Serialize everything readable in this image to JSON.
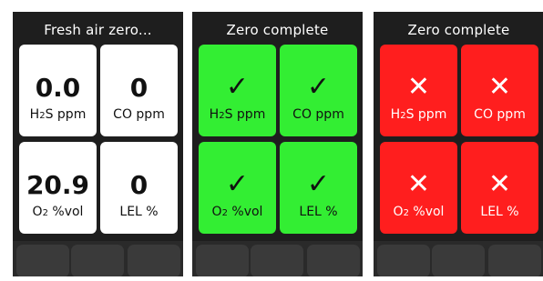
{
  "screens": [
    {
      "title": "Fresh air zero...",
      "tiles": [
        {
          "value": "0.0",
          "label_main": "H",
          "label_sub": "2",
          "label_rest": "S ppm"
        },
        {
          "value": "0",
          "label_main": "CO ppm",
          "label_sub": "",
          "label_rest": ""
        },
        {
          "value": "20.9",
          "label_main": "O",
          "label_sub": "2",
          "label_rest": " %vol"
        },
        {
          "value": "0",
          "label_main": "LEL %",
          "label_sub": "",
          "label_rest": ""
        }
      ],
      "colors": {
        "tile": "#ffffff"
      }
    },
    {
      "title": "Zero complete",
      "status": "success",
      "tiles": [
        {
          "glyph": "✓",
          "label_main": "H",
          "label_sub": "2",
          "label_rest": "S ppm"
        },
        {
          "glyph": "✓",
          "label_main": "CO ppm",
          "label_sub": "",
          "label_rest": ""
        },
        {
          "glyph": "✓",
          "label_main": "O",
          "label_sub": "2",
          "label_rest": " %vol"
        },
        {
          "glyph": "✓",
          "label_main": "LEL %",
          "label_sub": "",
          "label_rest": ""
        }
      ],
      "colors": {
        "tile": "#33ee33"
      }
    },
    {
      "title": "Zero complete",
      "status": "failure",
      "tiles": [
        {
          "glyph": "✕",
          "label_main": "H",
          "label_sub": "2",
          "label_rest": "S ppm"
        },
        {
          "glyph": "✕",
          "label_main": "CO ppm",
          "label_sub": "",
          "label_rest": ""
        },
        {
          "glyph": "✕",
          "label_main": "O",
          "label_sub": "2",
          "label_rest": " %vol"
        },
        {
          "glyph": "✕",
          "label_main": "LEL %",
          "label_sub": "",
          "label_rest": ""
        }
      ],
      "colors": {
        "tile": "#ff1e1e"
      }
    }
  ],
  "icons": {
    "success": "checkmark-icon",
    "failure": "x-mark-icon"
  }
}
